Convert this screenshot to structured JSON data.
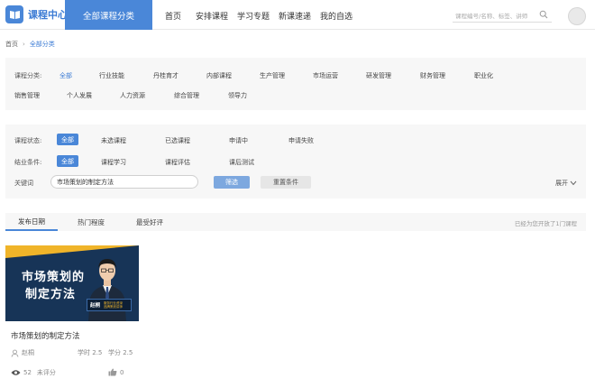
{
  "header": {
    "logo_text": "课程中心",
    "active_nav": "全部课程分类",
    "nav_items": [
      "首页",
      "安排课程",
      "学习专题",
      "新课速递",
      "我的自选"
    ],
    "search_placeholder": "课程编号/名称、标签、讲师"
  },
  "breadcrumb": {
    "home": "首页",
    "current": "全部分类"
  },
  "categories": {
    "label": "课程分类:",
    "items": [
      "全部",
      "行业技能",
      "丹桂育才",
      "内部课程",
      "生产管理",
      "市场运营",
      "研发管理",
      "财务管理",
      "职业化",
      "销售管理",
      "个人发展",
      "人力资源",
      "综合管理",
      "领导力"
    ]
  },
  "filters": {
    "status_label": "课程状态:",
    "status_options": [
      "全部",
      "未选课程",
      "已选课程",
      "申请中",
      "申请失败"
    ],
    "completion_label": "结业条件:",
    "completion_options": [
      "全部",
      "课程学习",
      "课程评估",
      "课后测试"
    ],
    "keyword_label": "关键词",
    "keyword_value": "市场策划的制定方法",
    "search_button": "筛选",
    "reset_button": "重置条件",
    "expand_label": "展开"
  },
  "sort": {
    "tabs": [
      "发布日期",
      "热门程度",
      "最受好评"
    ],
    "info": "已经为您开放了1门课程"
  },
  "course": {
    "thumb_line1": "市场策划的",
    "thumb_line2": "制定方法",
    "nametag_name": "赵桐",
    "nametag_desc1": "服务行业资深",
    "nametag_desc2": "品牌策划讲师",
    "title": "市场策划的制定方法",
    "instructor": "赵桐",
    "hours_label": "学时 2.5",
    "credits_label": "学分 2.5",
    "views": "52",
    "rating": "未评分",
    "likes": "0"
  }
}
